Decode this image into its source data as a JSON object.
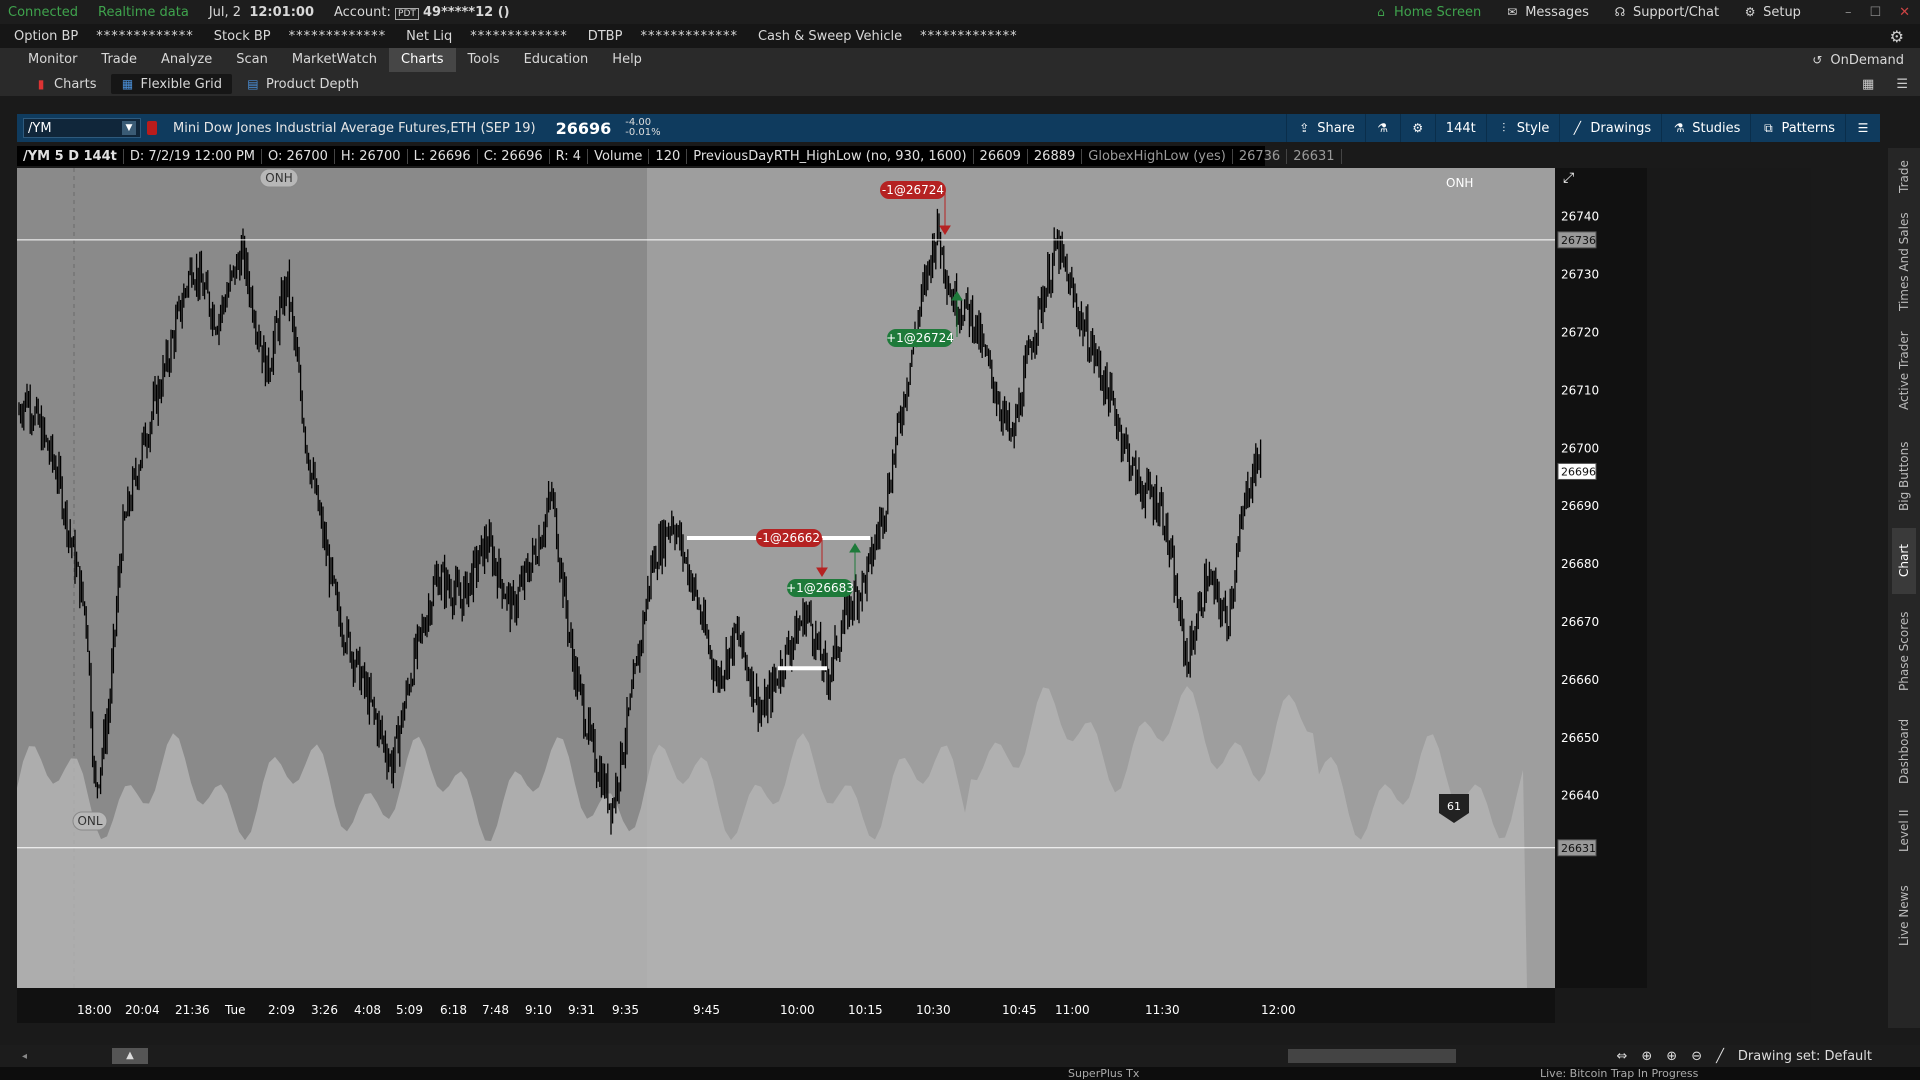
{
  "status": {
    "connected": "Connected",
    "realtime": "Realtime data",
    "date": "Jul, 2",
    "time": "12:01:00",
    "account_label": "Account:",
    "account_tag": "PDT",
    "account_value": "49*****12 ()",
    "home_screen": "Home Screen",
    "messages": "Messages",
    "support": "Support/Chat",
    "setup": "Setup"
  },
  "bp": [
    {
      "label": "Option BP",
      "value": "*************"
    },
    {
      "label": "Stock BP",
      "value": "*************"
    },
    {
      "label": "Net Liq",
      "value": "*************"
    },
    {
      "label": "DTBP",
      "value": "*************"
    },
    {
      "label": "Cash & Sweep Vehicle",
      "value": "*************"
    }
  ],
  "menu": [
    "Monitor",
    "Trade",
    "Analyze",
    "Scan",
    "MarketWatch",
    "Charts",
    "Tools",
    "Education",
    "Help"
  ],
  "menu_active": "Charts",
  "ondemand": "OnDemand",
  "subtabs": [
    "Charts",
    "Flexible Grid",
    "Product Depth"
  ],
  "chart_header": {
    "symbol": "/YM",
    "description": "Mini Dow Jones Industrial Average Futures,ETH (SEP 19)",
    "last": "26696",
    "change": "-4.00",
    "change_pct": "-0.01%",
    "tools": [
      "Share",
      "144t",
      "Style",
      "Drawings",
      "Studies",
      "Patterns"
    ]
  },
  "info": {
    "sym": "/YM 5 D 144t",
    "date": "D: 7/2/19 12:00 PM",
    "open": "O: 26700",
    "high": "H: 26700",
    "low": "L: 26696",
    "close": "C: 26696",
    "range": "R: 4",
    "volume_label": "Volume",
    "volume": "120",
    "study1": "PreviousDayRTH_HighLow (no, 930, 1600)",
    "study1_a": "26609",
    "study1_b": "26889",
    "study2": "GlobexHighLow (yes)",
    "study2_a": "26736",
    "study2_b": "26631"
  },
  "right_tabs": [
    "Trade",
    "Times And Sales",
    "Active Trader",
    "Big Buttons",
    "Chart",
    "Phase Scores",
    "Dashboard",
    "Level II",
    "Live News"
  ],
  "right_tab_active": "Chart",
  "bottom": {
    "drawing_set": "Drawing set: Default"
  },
  "below_text": [
    "SuperPlus Tx",
    "Live: Bitcoin Trap In Progress"
  ],
  "chart_data": {
    "type": "candlestick",
    "symbol": "/YM",
    "aggregation": "144 ticks",
    "y_ticks": [
      26640,
      26650,
      26660,
      26670,
      26680,
      26690,
      26700,
      26710,
      26720,
      26730,
      26740
    ],
    "ylim": [
      26630,
      26746
    ],
    "x_ticks": [
      "18:00",
      "20:04",
      "21:36",
      "Tue",
      "2:09",
      "3:26",
      "4:08",
      "5:09",
      "6:18",
      "7:48",
      "9:10",
      "9:31",
      "9:35",
      "9:45",
      "10:00",
      "10:15",
      "10:30",
      "10:45",
      "11:00",
      "11:30",
      "12:00"
    ],
    "price_path": [
      [
        0,
        26706
      ],
      [
        10,
        26709
      ],
      [
        40,
        26696
      ],
      [
        70,
        26670
      ],
      [
        78,
        26640
      ],
      [
        92,
        26655
      ],
      [
        105,
        26685
      ],
      [
        125,
        26700
      ],
      [
        150,
        26715
      ],
      [
        175,
        26732
      ],
      [
        200,
        26722
      ],
      [
        225,
        26734
      ],
      [
        250,
        26713
      ],
      [
        270,
        26729
      ],
      [
        290,
        26700
      ],
      [
        320,
        26672
      ],
      [
        345,
        26660
      ],
      [
        375,
        26645
      ],
      [
        395,
        26662
      ],
      [
        420,
        26678
      ],
      [
        445,
        26674
      ],
      [
        470,
        26684
      ],
      [
        495,
        26672
      ],
      [
        520,
        26683
      ],
      [
        535,
        26692
      ],
      [
        555,
        26664
      ],
      [
        575,
        26648
      ],
      [
        595,
        26638
      ],
      [
        615,
        26657
      ],
      [
        635,
        26680
      ],
      [
        655,
        26688
      ],
      [
        675,
        26677
      ],
      [
        700,
        26660
      ],
      [
        720,
        26668
      ],
      [
        745,
        26654
      ],
      [
        770,
        26665
      ],
      [
        790,
        26672
      ],
      [
        810,
        26660
      ],
      [
        830,
        26672
      ],
      [
        850,
        26678
      ],
      [
        870,
        26692
      ],
      [
        890,
        26712
      ],
      [
        905,
        26726
      ],
      [
        920,
        26738
      ],
      [
        935,
        26726
      ],
      [
        955,
        26723
      ],
      [
        975,
        26712
      ],
      [
        995,
        26701
      ],
      [
        1015,
        26719
      ],
      [
        1040,
        26735
      ],
      [
        1060,
        26724
      ],
      [
        1080,
        26715
      ],
      [
        1100,
        26705
      ],
      [
        1120,
        26694
      ],
      [
        1145,
        26690
      ],
      [
        1170,
        26663
      ],
      [
        1190,
        26678
      ],
      [
        1210,
        26670
      ],
      [
        1230,
        26693
      ],
      [
        1245,
        26700
      ]
    ],
    "levels": [
      {
        "label": "ONH",
        "value": 26736
      },
      {
        "label": "ONL",
        "value": 26631
      },
      {
        "label": "",
        "value": 26684.5
      },
      {
        "label": "",
        "value": 26662
      }
    ],
    "trades": [
      {
        "text": "-1@26724",
        "side": "sell",
        "x_tick": "10:30"
      },
      {
        "text": "+1@26724",
        "side": "buy",
        "x_tick": "10:30"
      },
      {
        "text": "-1@26662",
        "side": "sell",
        "x_tick": "10:00"
      },
      {
        "text": "+1@26683",
        "side": "buy",
        "x_tick": "10:15"
      }
    ],
    "price_labels": [
      {
        "value": 26736,
        "text": "26736"
      },
      {
        "value": 26696,
        "text": "26696"
      },
      {
        "value": 26631,
        "text": "26631"
      }
    ],
    "bubble": "61",
    "colors": {
      "bg": "#9e9e9e",
      "bg_old": "#8a8a8a",
      "candle": "#000000",
      "volume": "#b3b3b3",
      "sell": "#b52222",
      "buy": "#1e7a3a",
      "level": "#ffffff"
    }
  }
}
